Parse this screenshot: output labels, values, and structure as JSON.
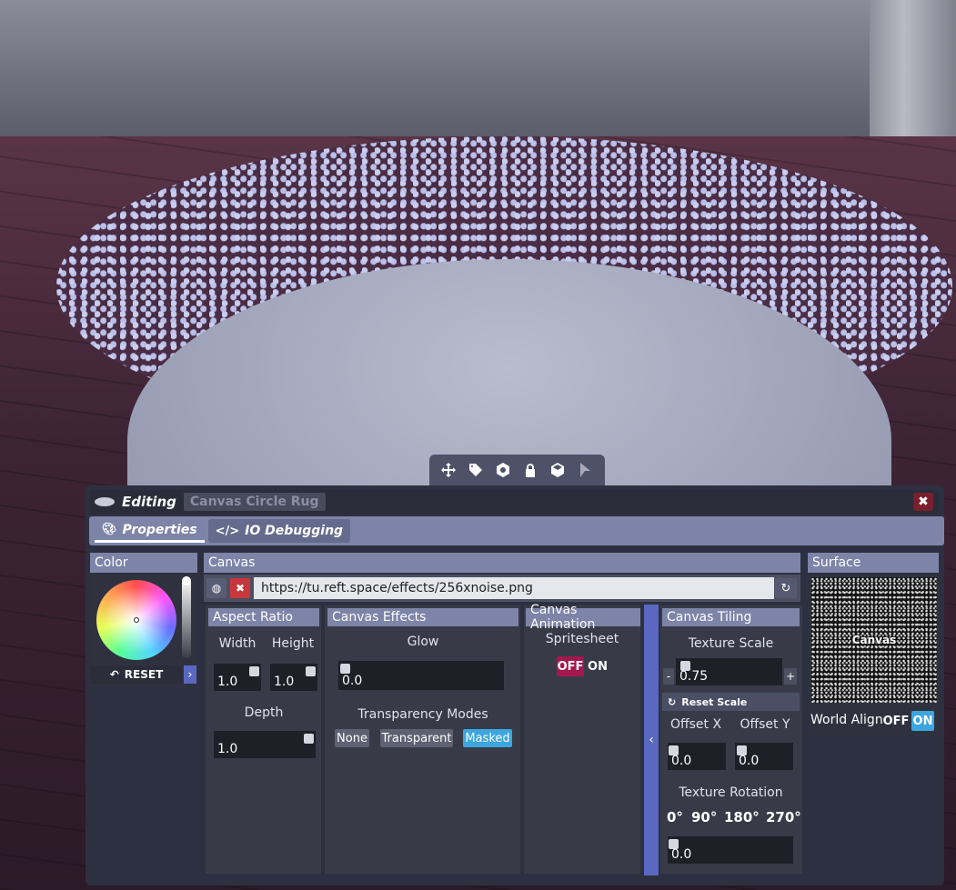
{
  "editor": {
    "title_label": "Editing",
    "object_name": "Canvas Circle Rug",
    "close_symbol": "✖"
  },
  "tabs": [
    {
      "label": "Properties",
      "icon": "palette-icon"
    },
    {
      "label": "IO Debugging",
      "icon": "code-icon"
    }
  ],
  "color": {
    "header": "Color",
    "reset_label": "RESET",
    "expand_symbol": "›"
  },
  "canvas": {
    "header": "Canvas",
    "url": "https://tu.reft.space/effects/256xnoise.png"
  },
  "aspect_ratio": {
    "header": "Aspect Ratio",
    "width_label": "Width",
    "height_label": "Height",
    "width_value": "1.0",
    "height_value": "1.0",
    "depth_label": "Depth",
    "depth_value": "1.0"
  },
  "effects": {
    "header": "Canvas Effects",
    "glow_label": "Glow",
    "glow_value": "0.0",
    "transparency_label": "Transparency Modes",
    "modes": [
      "None",
      "Transparent",
      "Masked"
    ],
    "active_mode": "Masked"
  },
  "animation": {
    "header": "Canvas Animation",
    "spritesheet_label": "Spritesheet",
    "off_label": "OFF",
    "on_label": "ON"
  },
  "tiling": {
    "header": "Canvas Tiling",
    "texture_scale_label": "Texture Scale",
    "texture_scale_value": "0.75",
    "minus": "-",
    "plus": "+",
    "reset_scale_label": "Reset Scale",
    "offset_x_label": "Offset X",
    "offset_y_label": "Offset Y",
    "offset_x_value": "0.0",
    "offset_y_value": "0.0",
    "rotation_label": "Texture Rotation",
    "rotations": [
      "0°",
      "90°",
      "180°",
      "270°"
    ],
    "rotation_value": "0.0",
    "collapse_symbol": "‹"
  },
  "surface": {
    "header": "Surface",
    "preview_label": "Canvas",
    "world_align_label": "World Align",
    "off_label": "OFF",
    "on_label": "ON"
  },
  "colors": {
    "accent": "#3ba7e0",
    "off_active": "#a3174f",
    "header_bg": "#7d84a8",
    "panel_bg": "#2d3040"
  }
}
